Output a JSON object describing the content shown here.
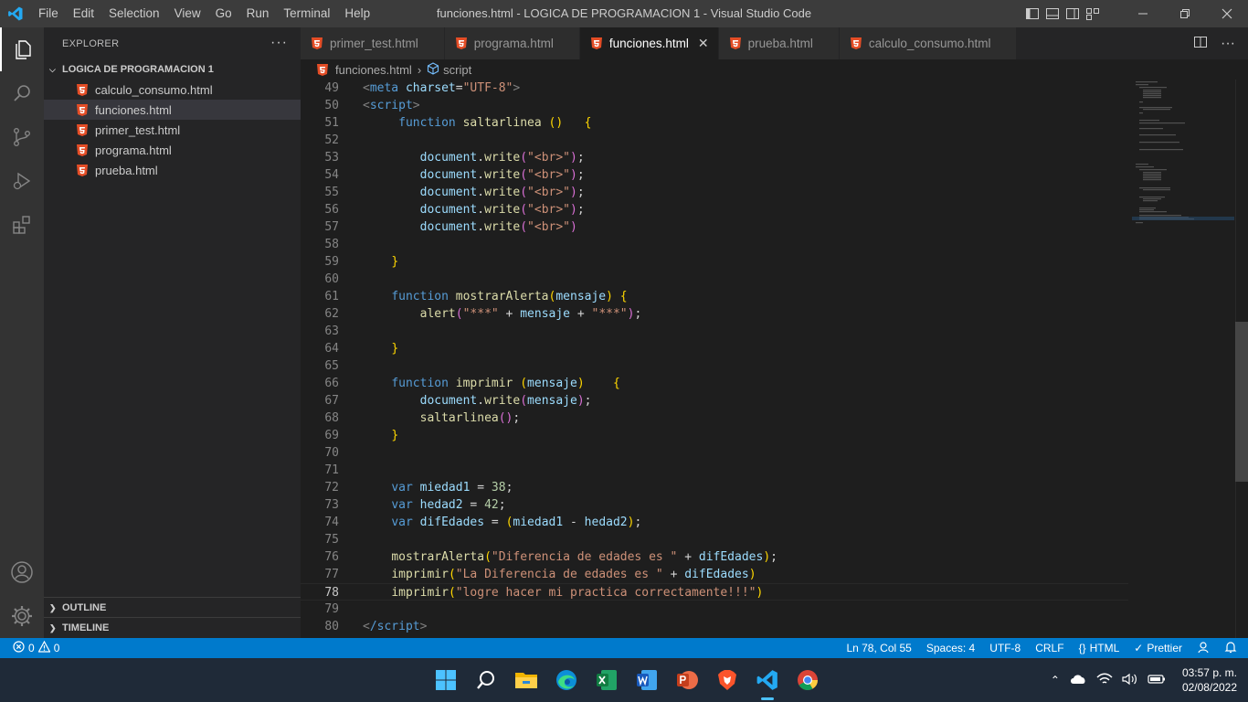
{
  "window": {
    "title": "funciones.html - LOGICA DE PROGRAMACION 1 - Visual Studio Code",
    "menu": [
      "File",
      "Edit",
      "Selection",
      "View",
      "Go",
      "Run",
      "Terminal",
      "Help"
    ]
  },
  "sidebar": {
    "header": "EXPLORER",
    "more": "···",
    "folder": "LOGICA DE PROGRAMACION 1",
    "files": [
      "calculo_consumo.html",
      "funciones.html",
      "primer_test.html",
      "programa.html",
      "prueba.html"
    ],
    "selected_file": "funciones.html",
    "outline": "OUTLINE",
    "timeline": "TIMELINE"
  },
  "tabs": [
    {
      "label": "primer_test.html",
      "active": false
    },
    {
      "label": "programa.html",
      "active": false
    },
    {
      "label": "funciones.html",
      "active": true
    },
    {
      "label": "prueba.html",
      "active": false
    },
    {
      "label": "calculo_consumo.html",
      "active": false
    }
  ],
  "breadcrumb": {
    "file": "funciones.html",
    "symbol": "script"
  },
  "editor": {
    "current_line": 78,
    "lines": [
      {
        "n": "49",
        "tokens": [
          [
            "<",
            "pun"
          ],
          [
            "meta ",
            "tag"
          ],
          [
            "charset",
            "attr"
          ],
          [
            "=",
            "op"
          ],
          [
            "\"UTF-8\"",
            "str"
          ],
          [
            ">",
            "pun"
          ]
        ]
      },
      {
        "n": "50",
        "tokens": [
          [
            "<",
            "pun"
          ],
          [
            "script",
            "tag"
          ],
          [
            ">",
            "pun"
          ]
        ]
      },
      {
        "n": "51",
        "tokens": [
          [
            "     ",
            "op"
          ],
          [
            "function ",
            "kw"
          ],
          [
            "saltarlinea ",
            "fn"
          ],
          [
            "()",
            "br1"
          ],
          [
            "   ",
            "op"
          ],
          [
            "{",
            "br1"
          ]
        ]
      },
      {
        "n": "52",
        "tokens": []
      },
      {
        "n": "53",
        "tokens": [
          [
            "        ",
            "op"
          ],
          [
            "document",
            "var"
          ],
          [
            ".",
            "op"
          ],
          [
            "write",
            "fn"
          ],
          [
            "(",
            "br2"
          ],
          [
            "\"<br>\"",
            "str"
          ],
          [
            ")",
            "br2"
          ],
          [
            ";",
            "op"
          ]
        ]
      },
      {
        "n": "54",
        "tokens": [
          [
            "        ",
            "op"
          ],
          [
            "document",
            "var"
          ],
          [
            ".",
            "op"
          ],
          [
            "write",
            "fn"
          ],
          [
            "(",
            "br2"
          ],
          [
            "\"<br>\"",
            "str"
          ],
          [
            ")",
            "br2"
          ],
          [
            ";",
            "op"
          ]
        ]
      },
      {
        "n": "55",
        "tokens": [
          [
            "        ",
            "op"
          ],
          [
            "document",
            "var"
          ],
          [
            ".",
            "op"
          ],
          [
            "write",
            "fn"
          ],
          [
            "(",
            "br2"
          ],
          [
            "\"<br>\"",
            "str"
          ],
          [
            ")",
            "br2"
          ],
          [
            ";",
            "op"
          ]
        ]
      },
      {
        "n": "56",
        "tokens": [
          [
            "        ",
            "op"
          ],
          [
            "document",
            "var"
          ],
          [
            ".",
            "op"
          ],
          [
            "write",
            "fn"
          ],
          [
            "(",
            "br2"
          ],
          [
            "\"<br>\"",
            "str"
          ],
          [
            ")",
            "br2"
          ],
          [
            ";",
            "op"
          ]
        ]
      },
      {
        "n": "57",
        "tokens": [
          [
            "        ",
            "op"
          ],
          [
            "document",
            "var"
          ],
          [
            ".",
            "op"
          ],
          [
            "write",
            "fn"
          ],
          [
            "(",
            "br2"
          ],
          [
            "\"<br>\"",
            "str"
          ],
          [
            ")",
            "br2"
          ]
        ]
      },
      {
        "n": "58",
        "tokens": []
      },
      {
        "n": "59",
        "tokens": [
          [
            "    ",
            "op"
          ],
          [
            "}",
            "br1"
          ]
        ]
      },
      {
        "n": "60",
        "tokens": []
      },
      {
        "n": "61",
        "tokens": [
          [
            "    ",
            "op"
          ],
          [
            "function ",
            "kw"
          ],
          [
            "mostrarAlerta",
            "fn"
          ],
          [
            "(",
            "br1"
          ],
          [
            "mensaje",
            "var"
          ],
          [
            ")",
            "br1"
          ],
          [
            " ",
            "op"
          ],
          [
            "{",
            "br1"
          ]
        ]
      },
      {
        "n": "62",
        "tokens": [
          [
            "        ",
            "op"
          ],
          [
            "alert",
            "fn"
          ],
          [
            "(",
            "br2"
          ],
          [
            "\"***\"",
            "str"
          ],
          [
            " + ",
            "op"
          ],
          [
            "mensaje",
            "var"
          ],
          [
            " + ",
            "op"
          ],
          [
            "\"***\"",
            "str"
          ],
          [
            ")",
            "br2"
          ],
          [
            ";",
            "op"
          ]
        ]
      },
      {
        "n": "63",
        "tokens": []
      },
      {
        "n": "64",
        "tokens": [
          [
            "    ",
            "op"
          ],
          [
            "}",
            "br1"
          ]
        ]
      },
      {
        "n": "65",
        "tokens": []
      },
      {
        "n": "66",
        "tokens": [
          [
            "    ",
            "op"
          ],
          [
            "function ",
            "kw"
          ],
          [
            "imprimir ",
            "fn"
          ],
          [
            "(",
            "br1"
          ],
          [
            "mensaje",
            "var"
          ],
          [
            ")",
            "br1"
          ],
          [
            "    ",
            "op"
          ],
          [
            "{",
            "br1"
          ]
        ]
      },
      {
        "n": "67",
        "tokens": [
          [
            "        ",
            "op"
          ],
          [
            "document",
            "var"
          ],
          [
            ".",
            "op"
          ],
          [
            "write",
            "fn"
          ],
          [
            "(",
            "br2"
          ],
          [
            "mensaje",
            "var"
          ],
          [
            ")",
            "br2"
          ],
          [
            ";",
            "op"
          ]
        ]
      },
      {
        "n": "68",
        "tokens": [
          [
            "        ",
            "op"
          ],
          [
            "saltarlinea",
            "fn"
          ],
          [
            "()",
            "br2"
          ],
          [
            ";",
            "op"
          ]
        ]
      },
      {
        "n": "69",
        "tokens": [
          [
            "    ",
            "op"
          ],
          [
            "}",
            "br1"
          ]
        ]
      },
      {
        "n": "70",
        "tokens": []
      },
      {
        "n": "71",
        "tokens": []
      },
      {
        "n": "72",
        "tokens": [
          [
            "    ",
            "op"
          ],
          [
            "var ",
            "kw"
          ],
          [
            "miedad1",
            "var"
          ],
          [
            " = ",
            "op"
          ],
          [
            "38",
            "num"
          ],
          [
            ";",
            "op"
          ]
        ]
      },
      {
        "n": "73",
        "tokens": [
          [
            "    ",
            "op"
          ],
          [
            "var ",
            "kw"
          ],
          [
            "hedad2",
            "var"
          ],
          [
            " = ",
            "op"
          ],
          [
            "42",
            "num"
          ],
          [
            ";",
            "op"
          ]
        ]
      },
      {
        "n": "74",
        "tokens": [
          [
            "    ",
            "op"
          ],
          [
            "var ",
            "kw"
          ],
          [
            "difEdades",
            "var"
          ],
          [
            " = ",
            "op"
          ],
          [
            "(",
            "br1"
          ],
          [
            "miedad1",
            "var"
          ],
          [
            " - ",
            "op"
          ],
          [
            "hedad2",
            "var"
          ],
          [
            ")",
            "br1"
          ],
          [
            ";",
            "op"
          ]
        ]
      },
      {
        "n": "75",
        "tokens": []
      },
      {
        "n": "76",
        "tokens": [
          [
            "    ",
            "op"
          ],
          [
            "mostrarAlerta",
            "fn"
          ],
          [
            "(",
            "br1"
          ],
          [
            "\"Diferencia de edades es \"",
            "str"
          ],
          [
            " + ",
            "op"
          ],
          [
            "difEdades",
            "var"
          ],
          [
            ")",
            "br1"
          ],
          [
            ";",
            "op"
          ]
        ]
      },
      {
        "n": "77",
        "tokens": [
          [
            "    ",
            "op"
          ],
          [
            "imprimir",
            "fn"
          ],
          [
            "(",
            "br1"
          ],
          [
            "\"La Diferencia de edades es \"",
            "str"
          ],
          [
            " + ",
            "op"
          ],
          [
            "difEdades",
            "var"
          ],
          [
            ")",
            "br1"
          ]
        ]
      },
      {
        "n": "78",
        "tokens": [
          [
            "    ",
            "op"
          ],
          [
            "imprimir",
            "fn"
          ],
          [
            "(",
            "br1"
          ],
          [
            "\"logre hacer mi practica correctamente!!!\"",
            "str"
          ],
          [
            ")",
            "br1"
          ]
        ]
      },
      {
        "n": "79",
        "tokens": []
      },
      {
        "n": "80",
        "tokens": [
          [
            "<",
            "pun"
          ],
          [
            "/script",
            "tag"
          ],
          [
            ">",
            "pun"
          ]
        ]
      }
    ]
  },
  "status": {
    "errors": "0",
    "warnings": "0",
    "position": "Ln 78, Col 55",
    "spaces": "Spaces: 4",
    "encoding": "UTF-8",
    "eol": "CRLF",
    "language": "HTML",
    "prettier": "Prettier"
  },
  "taskbar": {
    "time": "03:57 p. m.",
    "date": "02/08/2022"
  },
  "colors": {
    "accent": "#007acc",
    "html_icon": "#e44d26",
    "taskbar": "#1f2a38"
  }
}
